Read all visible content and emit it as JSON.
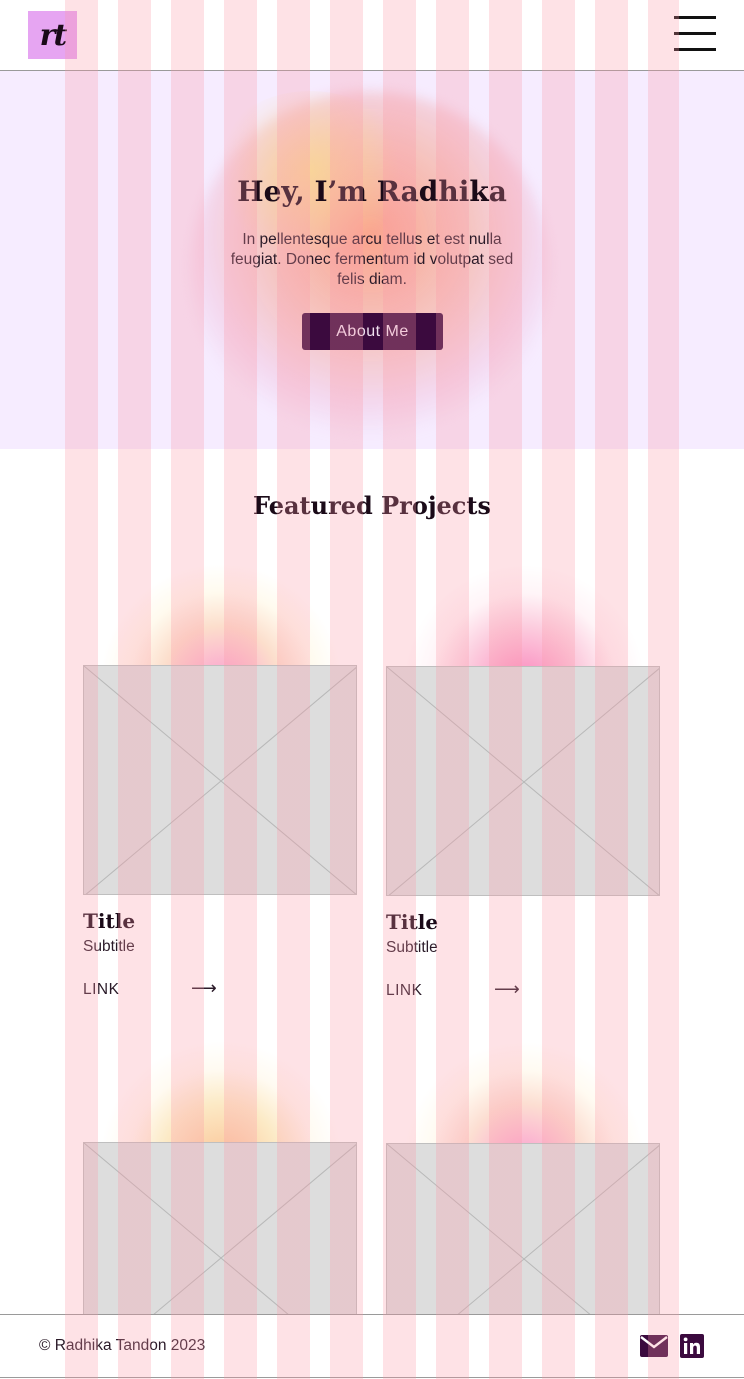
{
  "header": {
    "logo_text": "rt",
    "menu_icon": "hamburger-menu-icon"
  },
  "hero": {
    "title": "Hey, I’m Radhika",
    "text": "In pellentesque arcu tellus et est nulla feugiat. Donec fermentum id volutpat sed felis diam.",
    "button_label": "About Me"
  },
  "projects": {
    "heading": "Featured Projects",
    "cards": [
      {
        "title": "Title",
        "subtitle": "Subtitle",
        "link_label": "LINK",
        "arrow": "⟶"
      },
      {
        "title": "Title",
        "subtitle": "Subtitle",
        "link_label": "LINK",
        "arrow": "⟶"
      }
    ]
  },
  "footer": {
    "copyright": "© Radhika Tandon 2023",
    "icons": [
      "mail-icon",
      "linkedin-icon"
    ]
  },
  "colors": {
    "accent": "#3b0a3e",
    "logo_bg": "#e6a5f2",
    "hero_bg": "#f6ecff",
    "grid_overlay": "#fa96a5"
  }
}
